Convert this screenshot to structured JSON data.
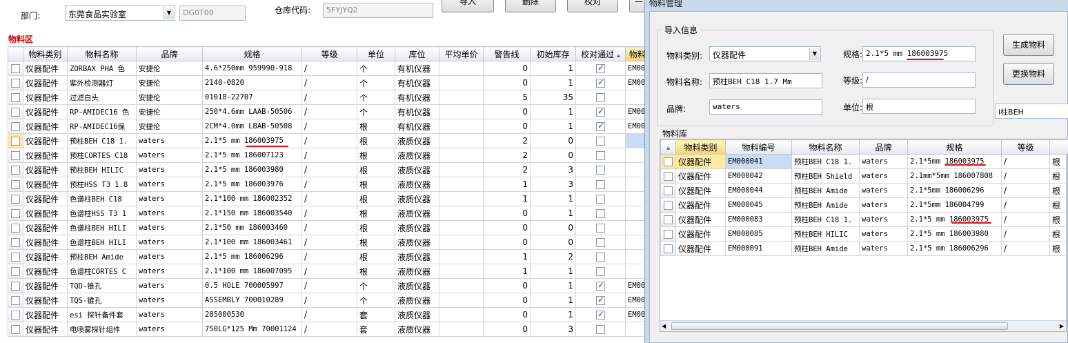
{
  "top": {
    "dept_label": "部门:",
    "dept_value": "东莞食品实验室",
    "dept_code": "DG0T00",
    "warehouse_label": "仓库代码:",
    "warehouse_value": "5FYJYQ2",
    "import_btn": "导入",
    "delete_btn": "删除",
    "check_btn": "校对",
    "minus_btn": "—"
  },
  "left": {
    "section_title": "物料区",
    "columns": [
      "物料类别",
      "物料名称",
      "品牌",
      "规格",
      "等级",
      "单位",
      "库位",
      "平均单价",
      "警告线",
      "初始库存",
      "校对通过",
      "物料"
    ],
    "rows": [
      {
        "cat": "仪器配件",
        "name": "ZORBAX PHA 色",
        "brand": "安捷伦",
        "spec": "4.6*250mm 959990-918",
        "grade": "/",
        "unit": "个",
        "loc": "有机仪器",
        "price": "",
        "warn": "0",
        "init": "1",
        "checked": true,
        "code": "EM00"
      },
      {
        "cat": "仪器配件",
        "name": "紫外检测器灯",
        "brand": "安捷伦",
        "spec": "2140-0820",
        "grade": "/",
        "unit": "个",
        "loc": "有机仪器",
        "price": "",
        "warn": "0",
        "init": "1",
        "checked": true,
        "code": "EM00"
      },
      {
        "cat": "仪器配件",
        "name": "过滤白头",
        "brand": "安捷伦",
        "spec": "01018-22707",
        "grade": "/",
        "unit": "个",
        "loc": "有机仪器",
        "price": "",
        "warn": "5",
        "init": "35",
        "checked": false,
        "code": ""
      },
      {
        "cat": "仪器配件",
        "name": "RP-AMIDEC16 色",
        "brand": "安捷伦",
        "spec": "250*4.6mm  LAAB-50506",
        "grade": "/",
        "unit": "个",
        "loc": "有机仪器",
        "price": "",
        "warn": "0",
        "init": "1",
        "checked": true,
        "code": "EM00"
      },
      {
        "cat": "仪器配件",
        "name": "RP-AMIDEC16保",
        "brand": "安捷伦",
        "spec": "2CM*4.0mm  LBAB-50508",
        "grade": "/",
        "unit": "根",
        "loc": "有机仪器",
        "price": "",
        "warn": "0",
        "init": "1",
        "checked": true,
        "code": "EM00"
      },
      {
        "cat": "仪器配件",
        "name": "预柱BEH C18 1.",
        "brand": "waters",
        "spec": "2.1*5 mm  186003975",
        "grade": "/",
        "unit": "根",
        "loc": "液质仪器",
        "price": "",
        "warn": "2",
        "init": "0",
        "checked": false,
        "code": ""
      },
      {
        "cat": "仪器配件",
        "name": "预柱CORTES C18",
        "brand": "waters",
        "spec": "2.1*5 mm 186007123",
        "grade": "/",
        "unit": "根",
        "loc": "液质仪器",
        "price": "",
        "warn": "2",
        "init": "0",
        "checked": false,
        "code": ""
      },
      {
        "cat": "仪器配件",
        "name": "预柱BEH HILIC",
        "brand": "waters",
        "spec": "2.1*5 mm  186003980",
        "grade": "/",
        "unit": "根",
        "loc": "液质仪器",
        "price": "",
        "warn": "2",
        "init": "3",
        "checked": false,
        "code": ""
      },
      {
        "cat": "仪器配件",
        "name": "预柱HSS T3 1.8",
        "brand": "waters",
        "spec": "2.1*5 mm  186003976",
        "grade": "/",
        "unit": "根",
        "loc": "液质仪器",
        "price": "",
        "warn": "1",
        "init": "3",
        "checked": false,
        "code": ""
      },
      {
        "cat": "仪器配件",
        "name": "色谱柱BEH C18",
        "brand": "waters",
        "spec": "2.1*100 mm  186002352",
        "grade": "/",
        "unit": "根",
        "loc": "液质仪器",
        "price": "",
        "warn": "1",
        "init": "1",
        "checked": false,
        "code": ""
      },
      {
        "cat": "仪器配件",
        "name": "色谱柱HSS T3 1",
        "brand": "waters",
        "spec": "2.1*150 mm  186003540",
        "grade": "/",
        "unit": "根",
        "loc": "液质仪器",
        "price": "",
        "warn": "0",
        "init": "1",
        "checked": false,
        "code": ""
      },
      {
        "cat": "仪器配件",
        "name": "色谱柱BEH HILI",
        "brand": "waters",
        "spec": "2.1*50 mm  186003460",
        "grade": "/",
        "unit": "根",
        "loc": "液质仪器",
        "price": "",
        "warn": "0",
        "init": "0",
        "checked": false,
        "code": ""
      },
      {
        "cat": "仪器配件",
        "name": "色谱柱BEH HILI",
        "brand": "waters",
        "spec": "2.1*100 mm 186003461",
        "grade": "/",
        "unit": "根",
        "loc": "液质仪器",
        "price": "",
        "warn": "0",
        "init": "0",
        "checked": false,
        "code": ""
      },
      {
        "cat": "仪器配件",
        "name": "预柱BEH Amide",
        "brand": "waters",
        "spec": "2.1*5 mm  186006296",
        "grade": "/",
        "unit": "根",
        "loc": "液质仪器",
        "price": "",
        "warn": "1",
        "init": "2",
        "checked": false,
        "code": ""
      },
      {
        "cat": "仪器配件",
        "name": "色谱柱CORTES C",
        "brand": "waters",
        "spec": "2.1*100 mm 186007095",
        "grade": "/",
        "unit": "根",
        "loc": "液质仪器",
        "price": "",
        "warn": "1",
        "init": "1",
        "checked": false,
        "code": ""
      },
      {
        "cat": "仪器配件",
        "name": "TQD-锥孔",
        "brand": "waters",
        "spec": "0.5 HOLE 700005997",
        "grade": "/",
        "unit": "个",
        "loc": "液质仪器",
        "price": "",
        "warn": "0",
        "init": "1",
        "checked": true,
        "code": "EM00"
      },
      {
        "cat": "仪器配件",
        "name": "TQS-锥孔",
        "brand": "waters",
        "spec": "ASSEMBLY 700010289",
        "grade": "/",
        "unit": "个",
        "loc": "液质仪器",
        "price": "",
        "warn": "0",
        "init": "1",
        "checked": true,
        "code": "EM00"
      },
      {
        "cat": "仪器配件",
        "name": "esi 探针备件套",
        "brand": "waters",
        "spec": "205000530",
        "grade": "/",
        "unit": "套",
        "loc": "液质仪器",
        "price": "",
        "warn": "0",
        "init": "1",
        "checked": true,
        "code": "EM00"
      },
      {
        "cat": "仪器配件",
        "name": "电喷雾探针组件",
        "brand": "waters",
        "spec": "750LG*125 Μm 70001124",
        "grade": "/",
        "unit": "套",
        "loc": "液质仪器",
        "price": "",
        "warn": "0",
        "init": "3",
        "checked": false,
        "code": ""
      }
    ]
  },
  "dialog": {
    "title": "物料管理",
    "import_group": "导入信息",
    "category_label": "物料类别:",
    "category_value": "仪器配件",
    "spec_label": "规格:",
    "spec_value": "2.1*5 mm  186003975",
    "name_label": "物料名称:",
    "name_value": "预柱BEH C18 1.7 Μm",
    "grade_label": "等级:",
    "grade_value": "/",
    "brand_label": "品牌:",
    "brand_value": "waters",
    "unit_label": "单位:",
    "unit_value": "根",
    "side_value": "i柱BEH",
    "gen_btn": "生成物料",
    "replace_btn": "更换物料",
    "library_title": "物料库",
    "columns": [
      "物料类别",
      "物料编号",
      "物料名称",
      "品牌",
      "规格",
      "等级",
      ""
    ],
    "rows": [
      {
        "cat": "仪器配件",
        "code": "EM000041",
        "name": "预柱BEH C18 1.",
        "brand": "waters",
        "spec": "2.1*5mm 186003975",
        "grade": "/",
        "unit": "根"
      },
      {
        "cat": "仪器配件",
        "code": "EM000042",
        "name": "预柱BEH Shield",
        "brand": "waters",
        "spec": "2.1mm*5mm 186007808",
        "grade": "/",
        "unit": "根"
      },
      {
        "cat": "仪器配件",
        "code": "EM000044",
        "name": "预柱BEH Amide",
        "brand": "waters",
        "spec": "2.1*5mm  186006296",
        "grade": "/",
        "unit": "根"
      },
      {
        "cat": "仪器配件",
        "code": "EM000045",
        "name": "预柱BEH Amide",
        "brand": "waters",
        "spec": "2.1*5mm  186004799",
        "grade": "/",
        "unit": "根"
      },
      {
        "cat": "仪器配件",
        "code": "EM000083",
        "name": "预柱BEH C18 1.",
        "brand": "waters",
        "spec": "2.1*5 mm   186003975",
        "grade": "/",
        "unit": "根"
      },
      {
        "cat": "仪器配件",
        "code": "EM000085",
        "name": "预柱BEH HILIC",
        "brand": "waters",
        "spec": "2.1*5 mm  186003980",
        "grade": "/",
        "unit": "根"
      },
      {
        "cat": "仪器配件",
        "code": "EM000091",
        "name": "预柱BEH Amide",
        "brand": "waters",
        "spec": "2.1*5 mm  186006296",
        "grade": "/",
        "unit": "根"
      }
    ]
  }
}
